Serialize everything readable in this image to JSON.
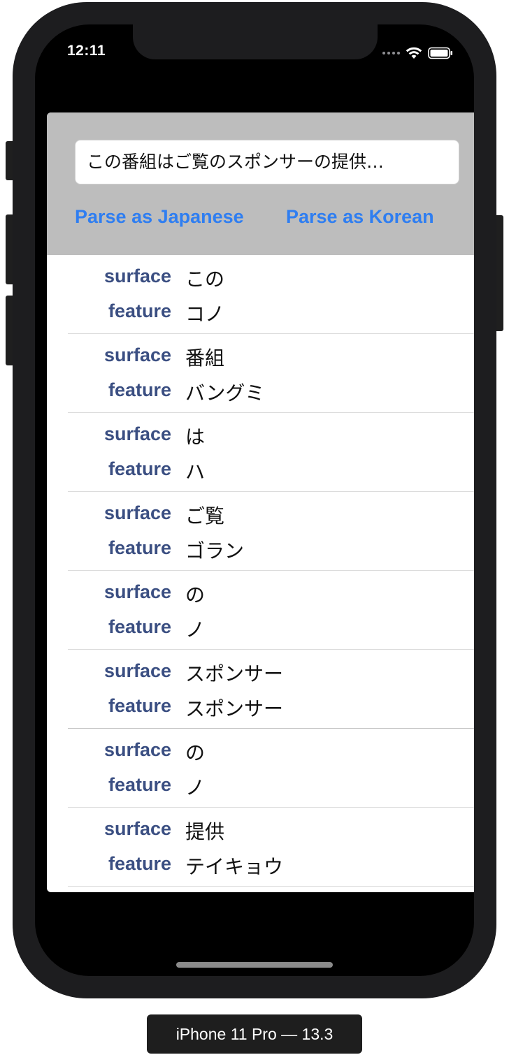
{
  "status_bar": {
    "time": "12:11"
  },
  "input": {
    "value": "この番組はご覧のスポンサーの提供…"
  },
  "buttons": {
    "parse_japanese": "Parse as Japanese",
    "parse_korean": "Parse as Korean"
  },
  "labels": {
    "surface": "surface",
    "feature": "feature"
  },
  "tokens": [
    {
      "surface": "この",
      "feature": "コノ"
    },
    {
      "surface": "番組",
      "feature": "バングミ"
    },
    {
      "surface": "は",
      "feature": "ハ"
    },
    {
      "surface": "ご覧",
      "feature": "ゴラン"
    },
    {
      "surface": "の",
      "feature": "ノ"
    },
    {
      "surface": "スポンサー",
      "feature": "スポンサー"
    },
    {
      "surface": "の",
      "feature": "ノ"
    },
    {
      "surface": "提供",
      "feature": "テイキョウ"
    }
  ],
  "device_caption": "iPhone 11 Pro — 13.3",
  "colors": {
    "accent": "#2f7ef1",
    "key_label": "#3b4f82",
    "header_bg": "#bdbdbd",
    "phone_body": "#1d1d1f"
  },
  "icons": {
    "signal": "cellular-signal-icon",
    "wifi": "wifi-icon",
    "battery": "battery-icon"
  }
}
